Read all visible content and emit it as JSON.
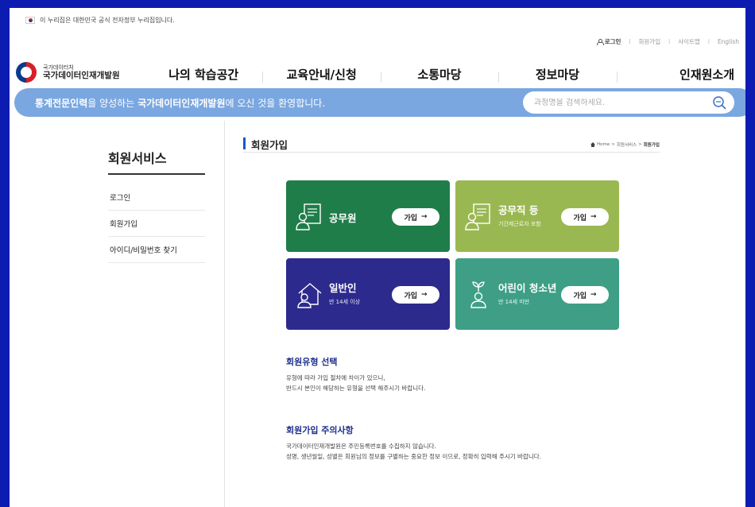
{
  "gov_banner": {
    "text": "이 누리집은 대한민국 공식 전자정부 누리집입니다."
  },
  "util": {
    "login": "로그인",
    "join": "회원가입",
    "sitemap": "사이트맵",
    "english": "English"
  },
  "logo": {
    "small": "국가데이터처",
    "large": "국가데이터인재개발원"
  },
  "gnb": [
    "나의 학습공간",
    "교육안내/신청",
    "소통마당",
    "정보마당",
    "인재원소개"
  ],
  "welcome": {
    "part1_bold": "통계전문인력",
    "part2": "을 양성하는 ",
    "part3_bold": "국가데이터인재개발원",
    "part4": "에 오신 것을 환영합니다.",
    "search_placeholder": "과정명을 검색하세요."
  },
  "sidebar": {
    "title": "회원서비스",
    "items": [
      "로그인",
      "회원가입",
      "아이디/비밀번호 찾기"
    ]
  },
  "page": {
    "title": "회원가입",
    "breadcrumb": {
      "home": "Home",
      "level1": "회원서비스",
      "current": "회원가입",
      "sep": ">"
    }
  },
  "cards": [
    {
      "title": "공무원",
      "sub": "",
      "button": "가입",
      "color": "#1f7d4a"
    },
    {
      "title": "공무직 등",
      "sub": "기간제근로자 포함",
      "button": "가입",
      "color": "#9ab851"
    },
    {
      "title": "일반인",
      "sub": "만 14세 이상",
      "button": "가입",
      "color": "#2d2a8e"
    },
    {
      "title": "어린이 청소년",
      "sub": "만 14세 미만",
      "button": "가입",
      "color": "#3e9f86"
    }
  ],
  "info": [
    {
      "title": "회원유형 선택",
      "lines": [
        "유형에 따라 가입 절차에 차이가 있으니,",
        "반드시 본인이 해당하는 유형을 선택 해주시기 바랍니다."
      ]
    },
    {
      "title": "회원가입 주의사항",
      "lines": [
        "국가데이터인재개발원은 주민등록번호를 수집하지 않습니다.",
        "성명, 생년월일, 성별은 회원님의 정보를 구별하는 중요한 정보 이므로, 정확히 입력해 주시기 바랍니다."
      ]
    }
  ]
}
